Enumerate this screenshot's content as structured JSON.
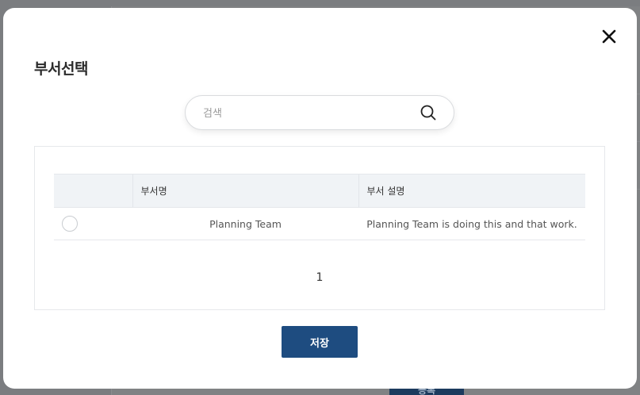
{
  "background": {
    "button_label": "등록"
  },
  "modal": {
    "title": "부서선택"
  },
  "search": {
    "placeholder": "검색",
    "value": ""
  },
  "table": {
    "columns": [
      "",
      "부서명",
      "부서 설명"
    ],
    "rows": [
      {
        "selected": false,
        "name": "Planning Team",
        "description": "Planning Team is doing this and that work."
      }
    ]
  },
  "pagination": {
    "current_page": "1"
  },
  "actions": {
    "save_label": "저장"
  },
  "colors": {
    "primary": "#1e4c80",
    "table_header_bg": "#f0f3f6",
    "overlay": "#7b7d80"
  },
  "icons": {
    "close": "close-icon",
    "search": "search-icon",
    "radio": "radio-icon"
  }
}
